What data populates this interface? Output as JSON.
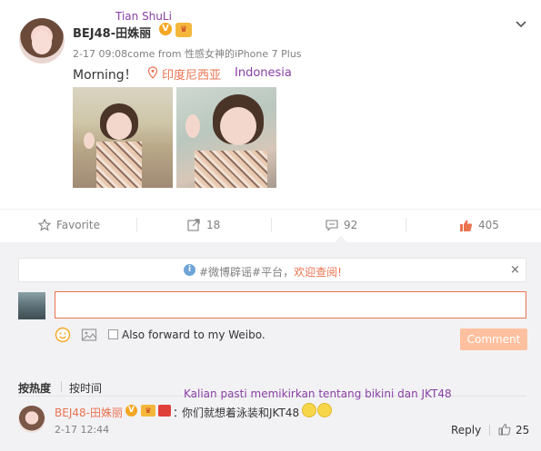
{
  "overlay": {
    "name_translation": "Tian ShuLi",
    "location_translation": "Indonesia",
    "comment_translation": "Kalian pasti memikirkan tentang bikini dan JKT48"
  },
  "post": {
    "username": "BEJ48-田姝丽",
    "verified_badge": "V",
    "vip_badge": "♛",
    "meta": "2-17 09:08come from 性感女神的iPhone 7 Plus",
    "text": "Morning！",
    "location": "印度尼西亚"
  },
  "actions": {
    "favorite_label": "Favorite",
    "forward_count": "18",
    "comment_count": "92",
    "like_count": "405"
  },
  "comments_section": {
    "notice_prefix": "#微博辟谣#平台，",
    "notice_link": "欢迎查阅!",
    "notice_icon": "i",
    "close_label": "×",
    "input_value": "",
    "forward_label": "Also forward to my Weibo.",
    "submit_label": "Comment",
    "sort_hot": "按热度",
    "sort_time": "按时间"
  },
  "comment": {
    "username": "BEJ48-田姝丽",
    "verified_badge": "V",
    "vip_badge": "♛",
    "colon": "：",
    "text": "你们就想着泳装和JKT48",
    "time": "2-17 12:44",
    "reply_label": "Reply",
    "like_count": "25"
  },
  "colors": {
    "accent": "#eb7350",
    "annotation": "#8a3fa4",
    "background": "#f2f2f5"
  }
}
